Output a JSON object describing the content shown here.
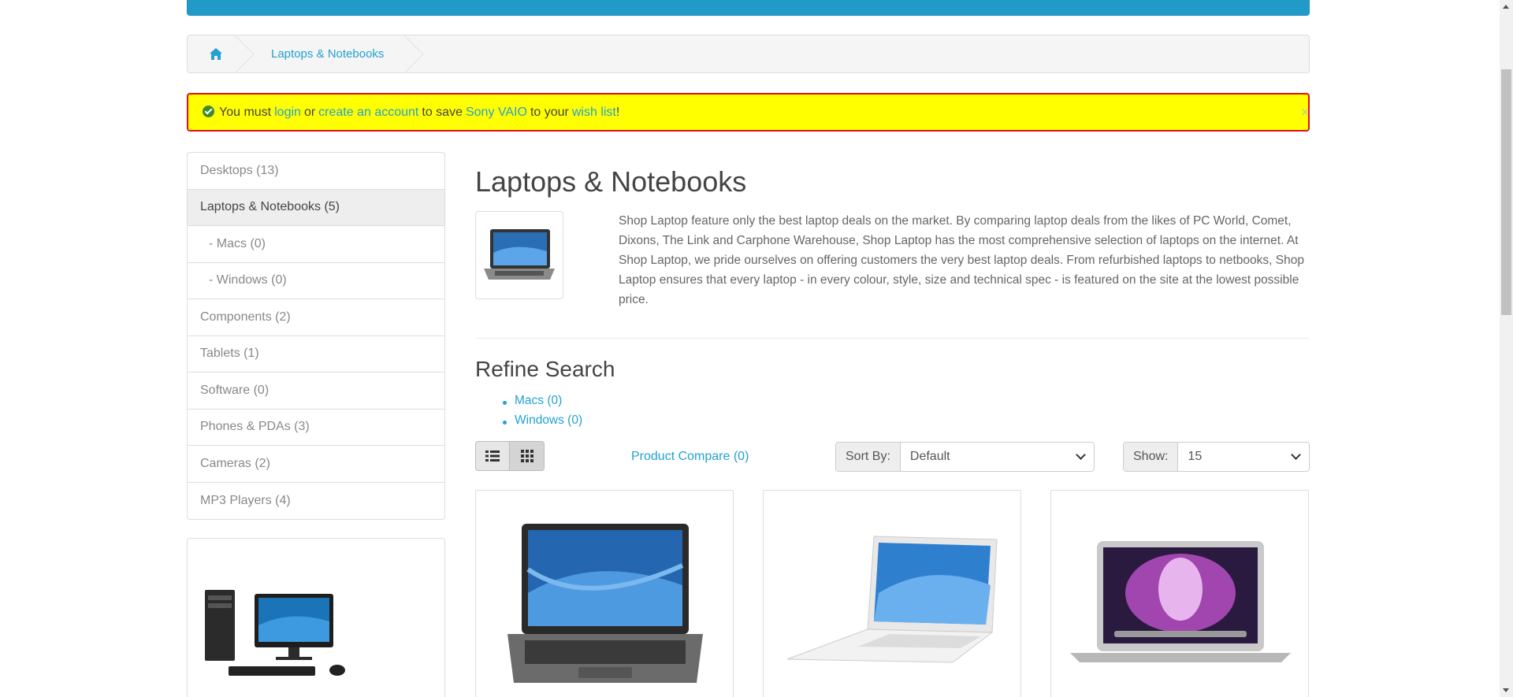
{
  "breadcrumb": {
    "home_icon": "home-icon",
    "current": "Laptops & Notebooks"
  },
  "alert": {
    "prefix": "You must",
    "login": "login",
    "or": "or",
    "create_account": "create an account",
    "to_save": "to save",
    "product": "Sony VAIO",
    "to_your": "to your",
    "wishlist": "wish list",
    "suffix": "!",
    "close": "×"
  },
  "sidebar": {
    "items": [
      {
        "label": "Desktops (13)"
      },
      {
        "label": "Laptops & Notebooks (5)"
      },
      {
        "label": "- Macs (0)"
      },
      {
        "label": "- Windows (0)"
      },
      {
        "label": "Components (2)"
      },
      {
        "label": "Tablets (1)"
      },
      {
        "label": "Software (0)"
      },
      {
        "label": "Phones & PDAs (3)"
      },
      {
        "label": "Cameras (2)"
      },
      {
        "label": "MP3 Players (4)"
      }
    ]
  },
  "main": {
    "title": "Laptops & Notebooks",
    "description": "Shop Laptop feature only the best laptop deals on the market. By comparing laptop deals from the likes of PC World, Comet, Dixons, The Link and Carphone Warehouse, Shop Laptop has the most comprehensive selection of laptops on the internet. At Shop Laptop, we pride ourselves on offering customers the very best laptop deals. From refurbished laptops to netbooks, Shop Laptop ensures that every laptop - in every colour, style, size and technical spec - is featured on the site at the lowest possible price.",
    "refine_title": "Refine Search",
    "refine_links": [
      "Macs (0)",
      "Windows (0)"
    ],
    "compare": "Product Compare (0)",
    "sort_label": "Sort By:",
    "sort_value": "Default",
    "show_label": "Show:",
    "show_value": "15"
  },
  "colors": {
    "accent": "#23a1d1",
    "topbar": "#229ac8",
    "alert_bg": "#ffff00",
    "alert_border": "#e0101a"
  }
}
